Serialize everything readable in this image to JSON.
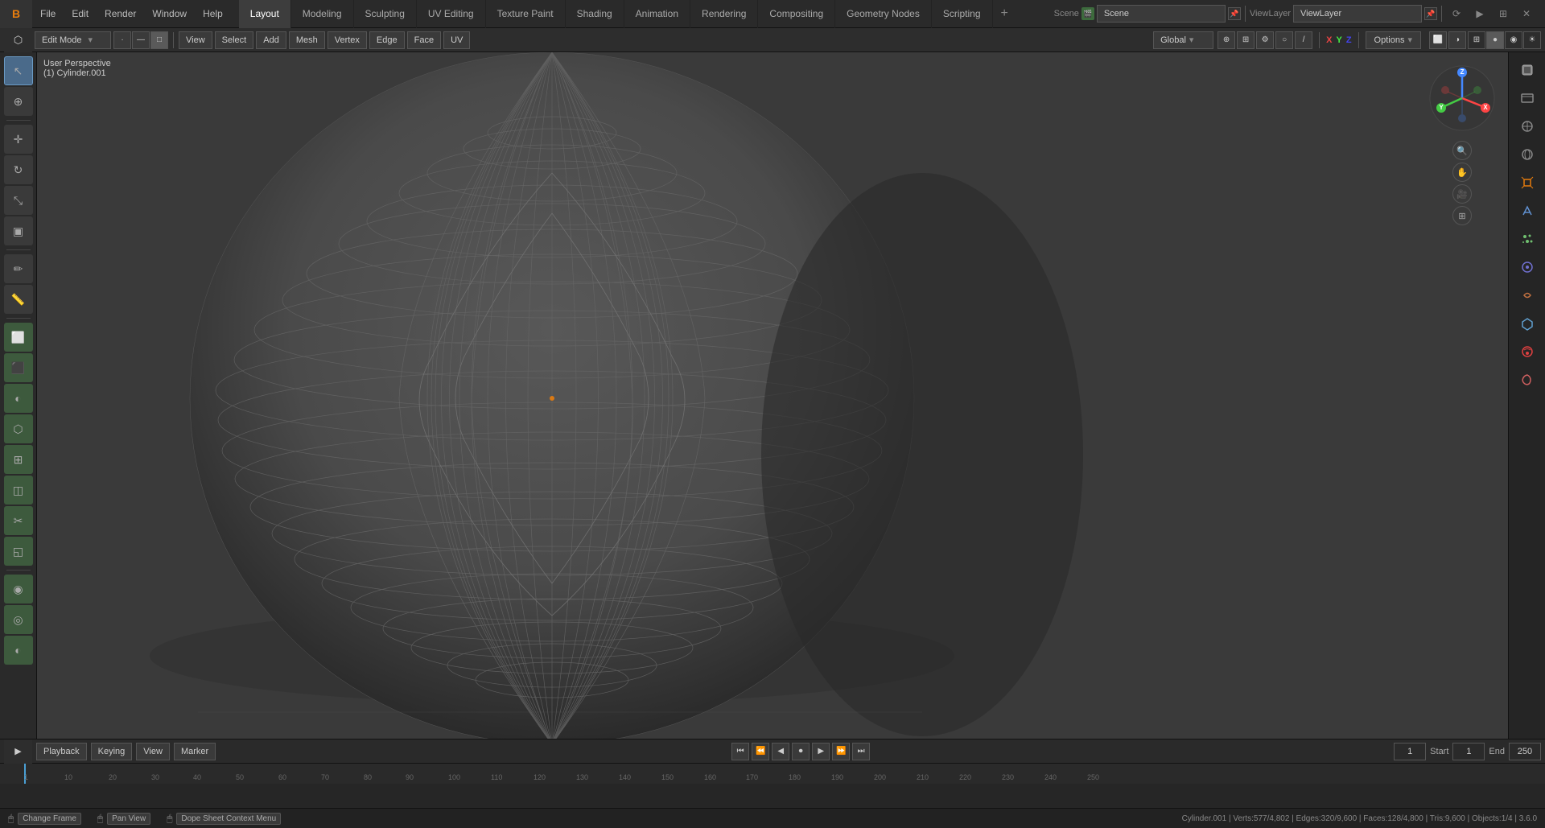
{
  "app": {
    "title": "Blender",
    "logo": "B"
  },
  "top_menu": {
    "items": [
      "File",
      "Edit",
      "Render",
      "Window",
      "Help"
    ]
  },
  "workspace_tabs": [
    {
      "label": "Layout",
      "active": true
    },
    {
      "label": "Modeling",
      "active": false
    },
    {
      "label": "Sculpting",
      "active": false
    },
    {
      "label": "UV Editing",
      "active": false
    },
    {
      "label": "Texture Paint",
      "active": false
    },
    {
      "label": "Shading",
      "active": false
    },
    {
      "label": "Animation",
      "active": false
    },
    {
      "label": "Rendering",
      "active": false
    },
    {
      "label": "Compositing",
      "active": false
    },
    {
      "label": "Geometry Nodes",
      "active": false
    },
    {
      "label": "Scripting",
      "active": false
    }
  ],
  "scene": {
    "name": "Scene",
    "view_layer": "ViewLayer"
  },
  "toolbar": {
    "mode": "Edit Mode",
    "mode_dropdown": "▾",
    "mesh_icons": [
      "□",
      "⬡",
      "▼"
    ],
    "view_label": "View",
    "select_label": "Select",
    "add_label": "Add",
    "mesh_label": "Mesh",
    "vertex_label": "Vertex",
    "edge_label": "Edge",
    "face_label": "Face",
    "uv_label": "UV",
    "transform_orient": "Global",
    "transform_pivot": "⊕",
    "snap_label": "⊞",
    "proportional_label": "○",
    "grease_pencil": "/",
    "options_label": "Options",
    "options_chevron": "▾",
    "xyz": {
      "x": "X",
      "y": "Y",
      "z": "Z"
    }
  },
  "viewport": {
    "info_line1": "User Perspective",
    "info_line2": "(1) Cylinder.001",
    "background_color": "#3a3a3a"
  },
  "left_tools": [
    {
      "icon": "↖",
      "name": "select-tool",
      "active": true
    },
    {
      "icon": "✚",
      "name": "cursor-tool"
    },
    {
      "icon": "⊕",
      "name": "move-tool"
    },
    {
      "icon": "↻",
      "name": "rotate-tool"
    },
    {
      "icon": "⤡",
      "name": "scale-tool"
    },
    {
      "icon": "▣",
      "name": "transform-tool"
    },
    {
      "separator": true
    },
    {
      "icon": "✏",
      "name": "annotate-tool"
    },
    {
      "icon": "⌄",
      "name": "measure-tool"
    },
    {
      "separator": true
    },
    {
      "icon": "⬜",
      "name": "cube-add"
    },
    {
      "icon": "⬛",
      "name": "extrude-tool"
    },
    {
      "icon": "◐",
      "name": "inset-tool"
    },
    {
      "icon": "⬡",
      "name": "bevel-tool"
    },
    {
      "icon": "⊞",
      "name": "loop-cut"
    },
    {
      "icon": "◫",
      "name": "offset-edge"
    },
    {
      "icon": "◧",
      "name": "knife-tool"
    },
    {
      "icon": "◱",
      "name": "bisect-tool"
    },
    {
      "separator": true
    },
    {
      "icon": "◉",
      "name": "smooth-tool"
    },
    {
      "icon": "◎",
      "name": "relax-tool"
    },
    {
      "icon": "◐",
      "name": "slide-tool"
    }
  ],
  "right_props": [
    {
      "icon": "🔧",
      "name": "active-tool-tab",
      "color": null
    },
    {
      "icon": "📷",
      "name": "view-tab",
      "color": null
    },
    {
      "icon": "🗃",
      "name": "scene-tab",
      "color": null
    },
    {
      "icon": "🌐",
      "name": "world-tab",
      "color": null
    },
    {
      "icon": "⬛",
      "name": "object-tab",
      "color": "#f08030"
    },
    {
      "icon": "▲",
      "name": "modifier-tab",
      "color": "#6090d0"
    },
    {
      "icon": "⚙",
      "name": "particles-tab",
      "color": "#70c070"
    },
    {
      "icon": "●",
      "name": "physics-tab",
      "color": "#7070d0"
    },
    {
      "icon": "◆",
      "name": "constraints-tab",
      "color": "#c07040"
    },
    {
      "icon": "🔗",
      "name": "data-tab",
      "color": "#60a0d0"
    },
    {
      "icon": "◑",
      "name": "material-tab",
      "color": "#e04040"
    },
    {
      "icon": "◕",
      "name": "shaderfx-tab",
      "color": "#d06060"
    }
  ],
  "timeline": {
    "playback_label": "Playback",
    "keying_label": "Keying",
    "view_label": "View",
    "marker_label": "Marker",
    "current_frame": "1",
    "start_frame": "1",
    "end_frame": "250",
    "start_label": "Start",
    "end_label": "End",
    "controls": {
      "jump_start": "⏮",
      "step_back": "⏪",
      "play_back": "◀",
      "record": "⏺",
      "play": "▶",
      "step_fwd": "⏩",
      "jump_end": "⏭"
    },
    "ruler_marks": [
      "10",
      "20",
      "30",
      "40",
      "50",
      "60",
      "70",
      "80",
      "90",
      "100",
      "110",
      "120",
      "130",
      "140",
      "150",
      "160",
      "170",
      "180",
      "190",
      "200",
      "210",
      "220",
      "230",
      "240",
      "250"
    ]
  },
  "footer": {
    "hints": [
      {
        "key": "Change Frame",
        "icon": "🖱"
      },
      {
        "key": "Pan View",
        "icon": "🖱"
      },
      {
        "key": "Dope Sheet Context Menu",
        "icon": "🖱"
      }
    ],
    "status": "Cylinder.001 | Verts:577/4,802 | Edges:320/9,600 | Faces:128/4,800 | Tris:9,600 | Objects:1/4 | 3.6.0"
  },
  "gizmo": {
    "x_color": "#e04444",
    "y_color": "#44e044",
    "z_color": "#4444e0"
  }
}
